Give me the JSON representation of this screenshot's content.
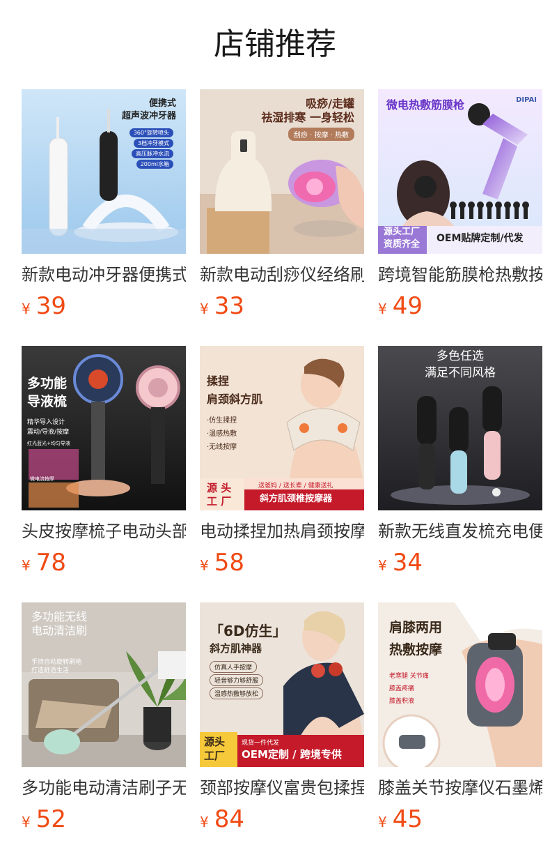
{
  "header": {
    "title": "店铺推荐"
  },
  "currency": "¥",
  "products": [
    {
      "name": "新款电动冲牙器便携式超声波冲牙器",
      "price": "39",
      "image_text": [
        "便携式",
        "超声波冲牙器",
        "360°旋转喷头",
        "3档冲牙模式",
        "高压脉冲水流",
        "200ml水箱"
      ]
    },
    {
      "name": "新款电动刮痧仪经络刷",
      "price": "33",
      "image_text": [
        "吸痧/走罐",
        "祛湿排寒 一身轻松",
        "刮痧 · 按摩 · 热敷"
      ]
    },
    {
      "name": "跨境智能筋膜枪热敷按摩器",
      "price": "49",
      "image_text": [
        "微电热敷筋膜枪",
        "DIPAI",
        "源头工厂",
        "资质齐全",
        "OEM贴牌定制/代发"
      ]
    },
    {
      "name": "头皮按摩梳子电动头部按摩器",
      "price": "78",
      "image_text": [
        "多功能",
        "导液梳",
        "精华导入设计",
        "震动/导液/按摩",
        "红光蓝光+均匀导液",
        "微电流按摩"
      ]
    },
    {
      "name": "电动揉捏加热肩颈按摩器",
      "price": "58",
      "image_text": [
        "揉捏",
        "肩颈斜方肌",
        "·仿生揉捏",
        "·温感热敷",
        "·无线按摩",
        "源 头",
        "工 厂",
        "送爸妈 / 送长辈 / 健康送礼",
        "斜方肌颈椎按摩器"
      ]
    },
    {
      "name": "新款无线直发梳充电便携",
      "price": "34",
      "image_text": [
        "多色任选",
        "满足不同风格"
      ]
    },
    {
      "name": "多功能电动清洁刷子无线",
      "price": "52",
      "image_text": [
        "多功能无线",
        "电动清洁刷",
        "手持自动旋转刷地",
        "打造舒适生活"
      ]
    },
    {
      "name": "颈部按摩仪富贵包揉捏按摩器",
      "price": "84",
      "image_text": [
        "「6D仿生」",
        "斜方肌神器",
        "仿真人手按摩",
        "轻音够力够舒服",
        "温感热敷够放松",
        "源头",
        "工厂",
        "现货一件代发",
        "OEM定制 / 跨境专供"
      ]
    },
    {
      "name": "膝盖关节按摩仪石墨烯热敷",
      "price": "45",
      "image_text": [
        "肩膝两用",
        "热敷按摩",
        "老寒腿 关节痛",
        "膝盖疼痛",
        "膝盖积液"
      ]
    }
  ]
}
